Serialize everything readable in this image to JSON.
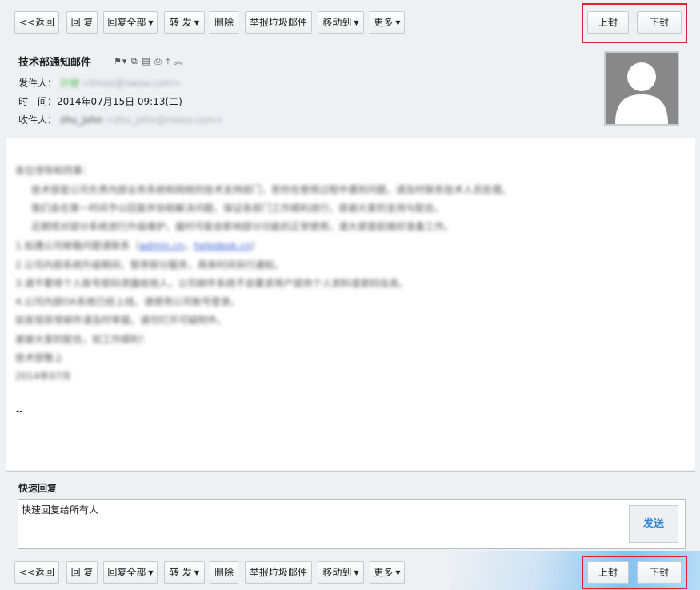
{
  "toolbar": {
    "back": "<<返回",
    "reply": "回 复",
    "reply_all": "回复全部",
    "forward": "转 发",
    "delete": "删除",
    "report_spam": "举报垃圾邮件",
    "move_to": "移动到",
    "more": "更多",
    "prev": "上封",
    "next": "下封"
  },
  "mail": {
    "subject": "技术部通知邮件",
    "sender_label": "发件人：",
    "sender_name": "孙健",
    "sender_email": "<Imoo@nwoo.com>",
    "time_label": "时　间：",
    "time_value": "2014年07月15日 09:13(二)",
    "recipient_label": "收件人：",
    "recipient_name": "zhu_john",
    "recipient_email": "<zhu_john@nwoo.com>"
  },
  "body": {
    "lines": [
      "各位领导和同事：",
      "技术部是公司负责内部业务系统和网络的技术支持部门，若你在使用过程中遇到问题，请及时联系技术人员处理。",
      "我们会在第一时间予以回复并协助解决问题，保证各部门工作顺利进行，感谢大家的支持与配合。",
      "近期将对部分系统进行升级维护，届时可能会影响部分功能的正常使用，请大家提前做好准备工作。",
      "1.如遇公司邮箱问题请联系（",
      "2.公司内部系统升级期间，暂停部分服务，具体时间另行通知。",
      "3.请不要将个人账号密码泄露给他人，公司邮件系统不会要求用户提供个人资料或密码信息。",
      "4.公司内部OA系统已经上线，请使用公司账号登录。",
      "如发现异常邮件请及时举报。请勿打开可疑附件。",
      "谢谢大家的配合，祝工作顺利！",
      "技术部敬上",
      "2014年07月"
    ],
    "link1": "admin.cn",
    "link2": "helpdesk.cn",
    "signature": "--"
  },
  "quick_reply": {
    "title": "快速回复",
    "text": "快速回复给所有人",
    "send": "发送"
  }
}
